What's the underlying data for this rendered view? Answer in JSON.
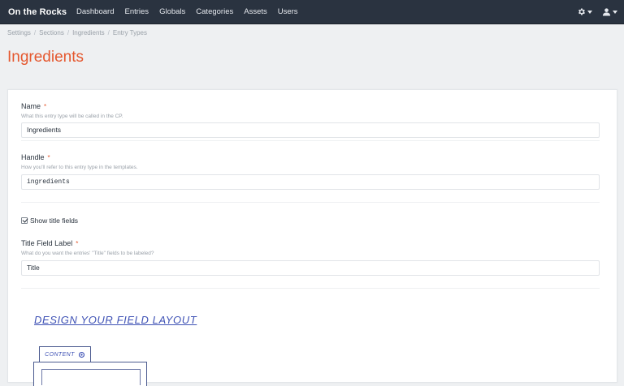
{
  "app": {
    "name": "On the Rocks"
  },
  "nav": {
    "items": [
      "Dashboard",
      "Entries",
      "Globals",
      "Categories",
      "Assets",
      "Users"
    ]
  },
  "tools": {
    "settings_icon": "gear-icon",
    "user_icon": "user-icon"
  },
  "breadcrumb": [
    "Settings",
    "Sections",
    "Ingredients",
    "Entry Types"
  ],
  "page": {
    "title": "Ingredients"
  },
  "form": {
    "name": {
      "label": "Name",
      "required": "*",
      "instructions": "What this entry type will be called in the CP.",
      "value": "Ingredients"
    },
    "handle": {
      "label": "Handle",
      "required": "*",
      "instructions": "How you'll refer to this entry type in the templates.",
      "value": "ingredients"
    },
    "show_title": {
      "label": "Show title fields",
      "checked": true
    },
    "title_label": {
      "label": "Title Field Label",
      "required": "*",
      "instructions": "What do you want the entries' \"Title\" fields to be labeled?",
      "value": "Title"
    }
  },
  "designer": {
    "title": "DESIGN YOUR FIELD LAYOUT",
    "tab": {
      "label": "CONTENT",
      "icon": "gear-icon"
    }
  },
  "colors": {
    "nav_bg": "#2a3340",
    "accent": "#e5582f",
    "designer_blue": "#3f52b5"
  }
}
